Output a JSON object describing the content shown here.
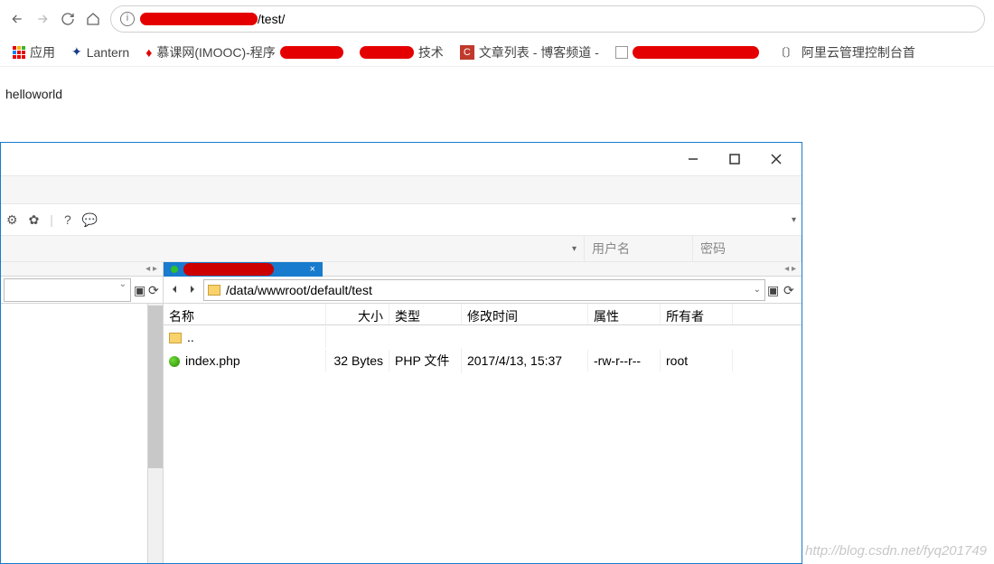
{
  "browser": {
    "url_suffix": "/test/",
    "bookmarks": {
      "apps": "应用",
      "lantern": "Lantern",
      "imooc": "慕课网(IMOOC)-程序",
      "tech": "技术",
      "blog": "文章列表 - 博客频道 -",
      "aliyun": "阿里云管理控制台首"
    }
  },
  "page": {
    "text": "helloworld"
  },
  "ftp": {
    "username_ph": "用户名",
    "password_ph": "密码",
    "remote_path": "/data/wwwroot/default/test",
    "columns": {
      "name": "名称",
      "size": "大小",
      "type": "类型",
      "mtime": "修改时间",
      "attr": "属性",
      "owner": "所有者"
    },
    "up_label": "..",
    "files": [
      {
        "name": "index.php",
        "size": "32 Bytes",
        "type": "PHP 文件",
        "mtime": "2017/4/13, 15:37",
        "attr": "-rw-r--r--",
        "owner": "root"
      }
    ]
  },
  "watermark": "http://blog.csdn.net/fyq201749"
}
